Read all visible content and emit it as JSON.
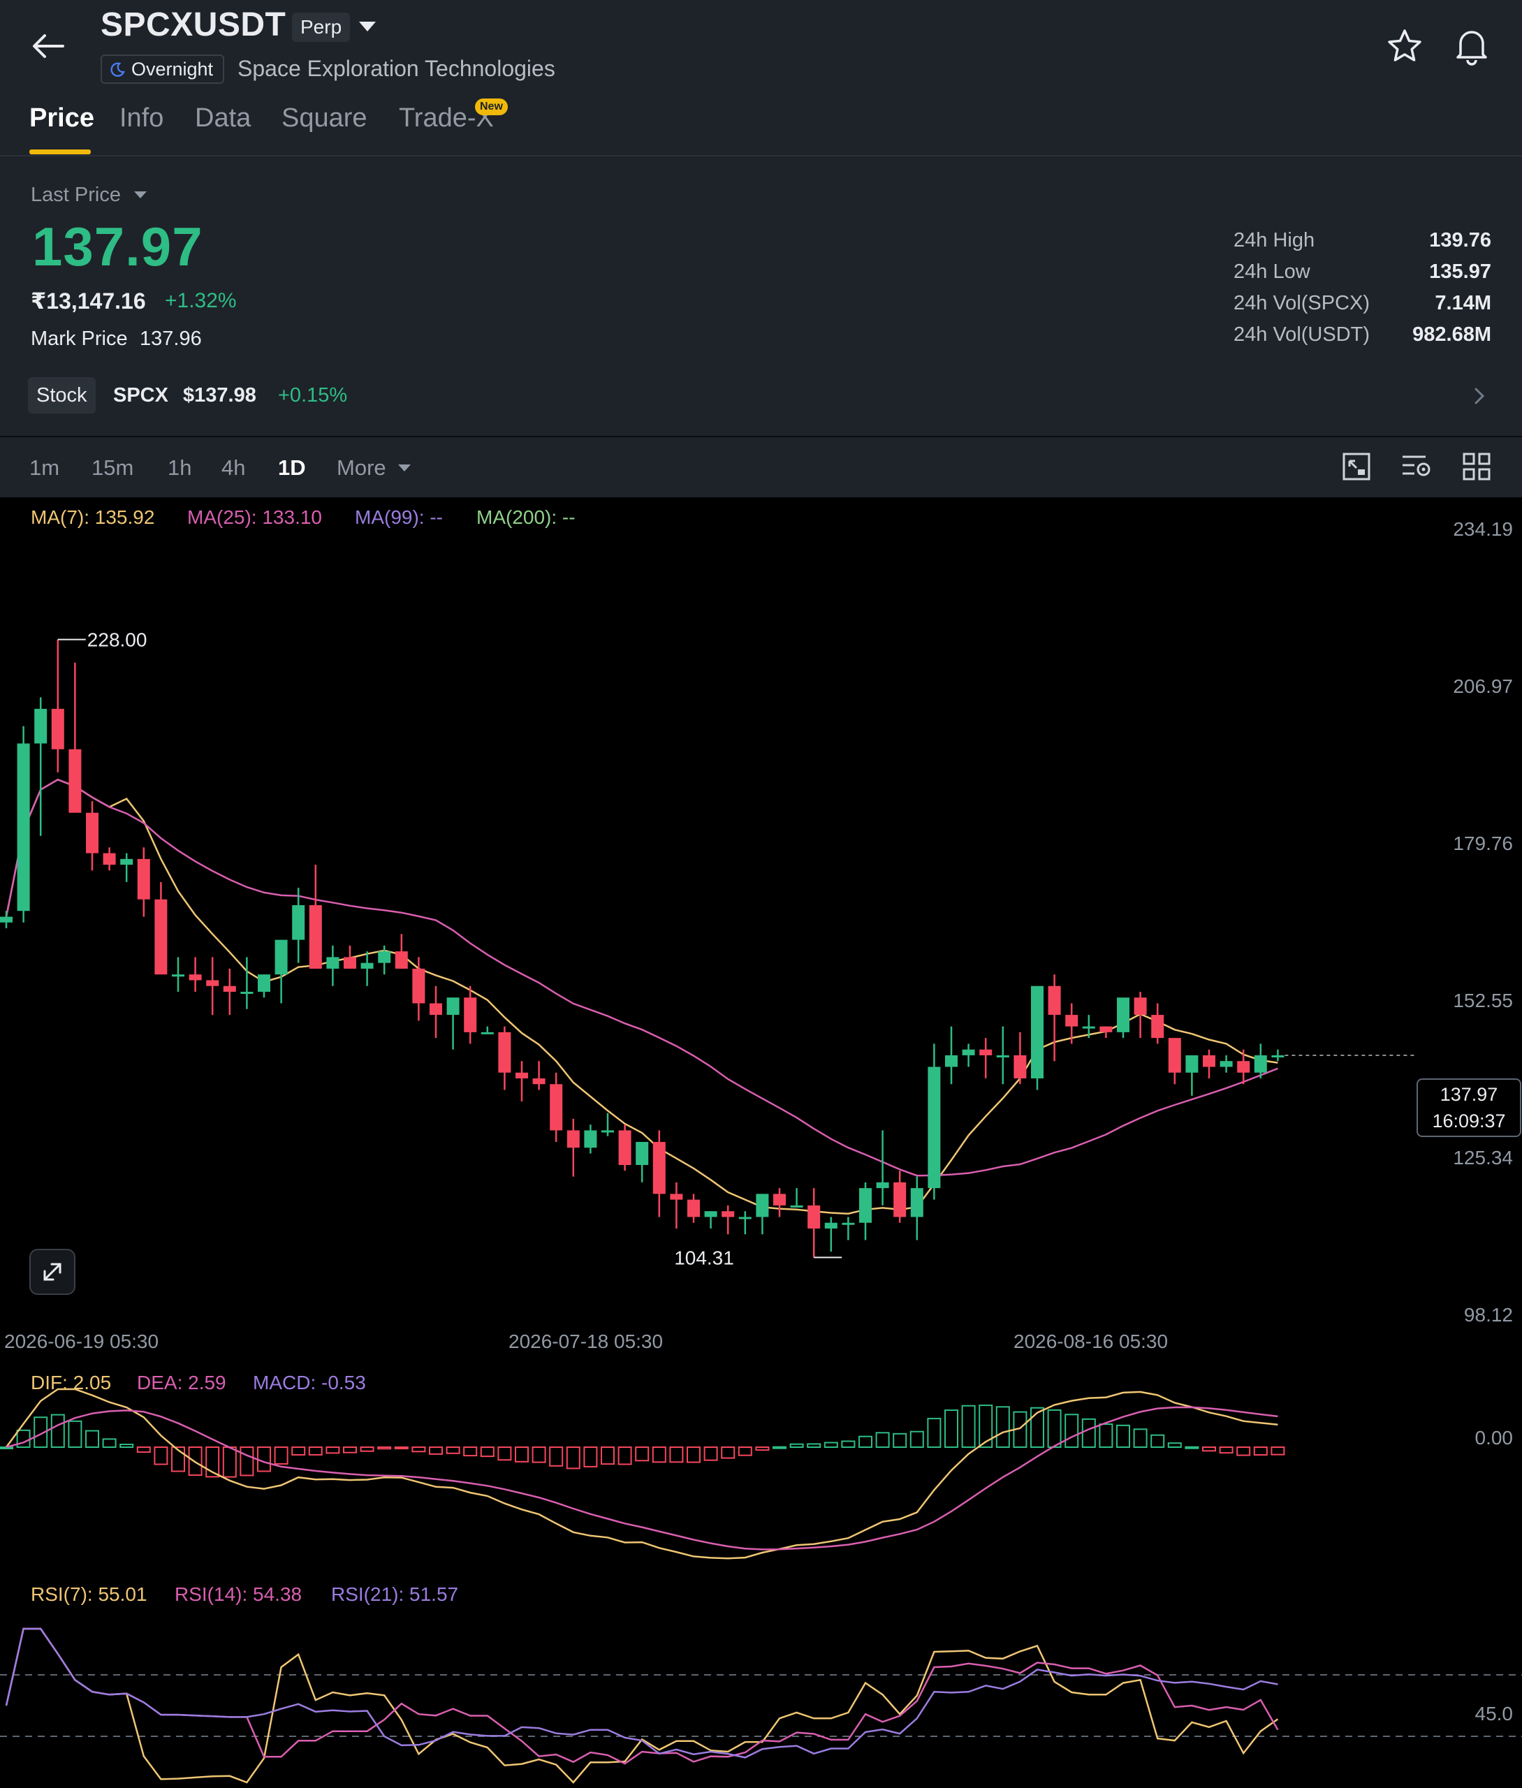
{
  "header": {
    "symbol": "SPCXUSDT",
    "contract_type": "Perp",
    "session_badge": "Overnight",
    "company_name": "Space Exploration Technologies",
    "tabs": [
      {
        "label": "Price",
        "active": true
      },
      {
        "label": "Info",
        "active": false
      },
      {
        "label": "Data",
        "active": false
      },
      {
        "label": "Square",
        "active": false
      },
      {
        "label": "Trade-X",
        "active": false
      }
    ],
    "new_badge": "New"
  },
  "price_panel": {
    "last_price_label": "Last Price",
    "last_price": "137.97",
    "inr_price": "₹13,147.16",
    "change_pct": "+1.32%",
    "mark_price_label": "Mark Price",
    "mark_price": "137.96",
    "stats": [
      {
        "label": "24h High",
        "value": "139.76"
      },
      {
        "label": "24h Low",
        "value": "135.97"
      },
      {
        "label": "24h Vol(SPCX)",
        "value": "7.14M"
      },
      {
        "label": "24h Vol(USDT)",
        "value": "982.68M"
      }
    ],
    "stock": {
      "badge": "Stock",
      "symbol": "SPCX",
      "price": "$137.98",
      "change": "+0.15%"
    }
  },
  "intervals": {
    "items": [
      {
        "label": "1m",
        "active": false
      },
      {
        "label": "15m",
        "active": false
      },
      {
        "label": "1h",
        "active": false
      },
      {
        "label": "4h",
        "active": false
      },
      {
        "label": "1D",
        "active": true
      }
    ],
    "more_label": "More"
  },
  "colors": {
    "up": "#2ebd85",
    "down": "#f6465d",
    "accent": "#f0b90b",
    "ma7": "#f0c674",
    "ma25": "#d95fb0",
    "ma99": "#9b7de0",
    "ma200": "#8fd18a",
    "background": "#000000"
  },
  "chart_data": {
    "type": "candlestick",
    "ma_legend": [
      {
        "label": "MA(7): 135.92",
        "color": "#f0c674"
      },
      {
        "label": "MA(25): 133.10",
        "color": "#d95fb0"
      },
      {
        "label": "MA(99): --",
        "color": "#9b7de0"
      },
      {
        "label": "MA(200): --",
        "color": "#8fd18a"
      }
    ],
    "y_ticks": [
      "234.19",
      "206.97",
      "179.76",
      "152.55",
      "125.34",
      "98.12"
    ],
    "y_tick_values": [
      234.19,
      206.97,
      179.76,
      152.55,
      125.34,
      98.12
    ],
    "x_ticks": [
      "2026-06-19 05:30",
      "2026-07-18 05:30",
      "2026-08-16 05:30"
    ],
    "high_label": "228.00",
    "low_label": "104.31",
    "current_price": "137.97",
    "countdown": "16:09:37",
    "candles": [
      [
        166,
        168,
        165,
        167
      ],
      [
        168,
        200,
        166,
        197
      ],
      [
        197,
        205,
        181,
        203
      ],
      [
        203,
        215,
        192,
        196
      ],
      [
        196,
        211,
        189,
        185
      ],
      [
        185,
        187,
        175,
        178
      ],
      [
        178,
        179,
        175,
        176
      ],
      [
        176,
        178,
        173,
        177
      ],
      [
        177,
        179,
        167,
        170
      ],
      [
        170,
        173,
        161,
        157
      ],
      [
        157,
        160,
        154,
        157
      ],
      [
        157,
        160,
        154,
        156
      ],
      [
        156,
        160,
        150,
        155
      ],
      [
        155,
        158,
        150,
        154
      ],
      [
        154,
        160,
        151,
        154
      ],
      [
        154,
        157,
        153,
        157
      ],
      [
        157,
        163,
        152,
        163
      ],
      [
        163,
        172,
        159,
        169
      ],
      [
        169,
        176,
        158,
        158
      ],
      [
        158,
        162,
        155,
        160
      ],
      [
        160,
        162,
        158,
        158
      ],
      [
        158,
        161,
        155,
        159
      ],
      [
        159,
        162,
        157,
        161
      ],
      [
        161,
        164,
        158,
        158
      ],
      [
        158,
        160,
        149,
        152
      ],
      [
        152,
        155,
        146,
        150
      ],
      [
        150,
        153,
        144,
        153
      ],
      [
        153,
        155,
        145,
        147
      ],
      [
        147,
        148,
        147,
        147
      ],
      [
        147,
        148,
        137,
        140
      ],
      [
        140,
        142,
        135,
        139
      ],
      [
        139,
        142,
        137,
        138
      ],
      [
        138,
        140,
        128,
        130
      ],
      [
        130,
        132,
        122,
        127
      ],
      [
        127,
        131,
        126,
        130
      ],
      [
        130,
        133,
        129,
        130
      ],
      [
        130,
        131,
        123,
        124
      ],
      [
        124,
        128,
        121,
        128
      ],
      [
        128,
        130,
        115,
        119
      ],
      [
        119,
        121,
        113,
        118
      ],
      [
        118,
        119,
        114,
        115
      ],
      [
        115,
        116,
        113,
        116
      ],
      [
        116,
        117,
        112,
        115
      ],
      [
        115,
        116,
        112,
        115
      ],
      [
        115,
        119,
        112,
        119
      ],
      [
        119,
        120,
        115,
        117
      ],
      [
        117,
        120,
        117,
        117
      ],
      [
        117,
        120,
        108,
        113
      ],
      [
        113,
        115,
        109,
        114
      ],
      [
        114,
        115,
        111,
        114
      ],
      [
        114,
        121,
        111,
        120
      ],
      [
        120,
        130,
        117,
        121
      ],
      [
        121,
        123,
        114,
        115
      ],
      [
        115,
        122,
        111,
        120
      ],
      [
        120,
        145,
        118,
        141
      ],
      [
        141,
        148,
        138,
        143
      ],
      [
        143,
        145,
        141,
        144
      ],
      [
        144,
        146,
        139,
        143
      ],
      [
        143,
        148,
        138,
        143
      ],
      [
        143,
        147,
        138,
        139
      ],
      [
        139,
        153,
        137,
        155
      ],
      [
        155,
        157,
        142,
        150
      ],
      [
        150,
        152,
        145,
        148
      ],
      [
        148,
        150,
        146,
        148
      ],
      [
        148,
        148,
        146,
        147
      ],
      [
        147,
        152,
        146,
        153
      ],
      [
        153,
        154,
        146,
        150
      ],
      [
        150,
        152,
        145,
        146
      ],
      [
        146,
        146,
        138,
        140
      ],
      [
        140,
        143,
        136,
        143
      ],
      [
        143,
        144,
        139,
        141
      ],
      [
        141,
        143,
        140,
        142
      ],
      [
        142,
        144,
        138,
        140
      ],
      [
        140,
        145,
        139,
        143
      ],
      [
        143,
        144,
        142,
        143
      ]
    ],
    "macd_legend": [
      {
        "label": "DIF: 2.05",
        "color": "#f0c674"
      },
      {
        "label": "DEA: 2.59",
        "color": "#d95fb0"
      },
      {
        "label": "MACD: -0.53",
        "color": "#9b7de0"
      }
    ],
    "macd_zero_label": "0.00",
    "rsi_legend": [
      {
        "label": "RSI(7): 55.01",
        "color": "#f0c674"
      },
      {
        "label": "RSI(14): 54.38",
        "color": "#d95fb0"
      },
      {
        "label": "RSI(21): 51.57",
        "color": "#9b7de0"
      }
    ],
    "rsi_tick_label": "45.0"
  }
}
